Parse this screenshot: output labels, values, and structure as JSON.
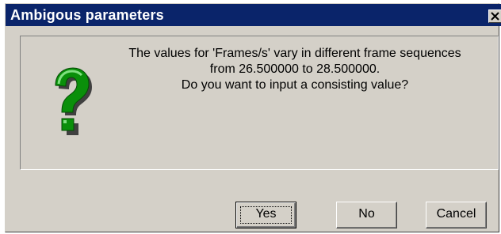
{
  "window": {
    "title": "Ambigous parameters",
    "close_icon": "close-icon"
  },
  "message": {
    "icon": "question-icon",
    "icon_color": "#0a8f0a",
    "lines": [
      "The values for 'Frames/s' vary in different frame sequences",
      "from 26.500000 to 28.500000.",
      "Do you want to input a consisting value?"
    ]
  },
  "buttons": {
    "yes": "Yes",
    "no": "No",
    "cancel": "Cancel"
  },
  "colors": {
    "titlebar": "#0a246a",
    "face": "#d4d0c8"
  }
}
